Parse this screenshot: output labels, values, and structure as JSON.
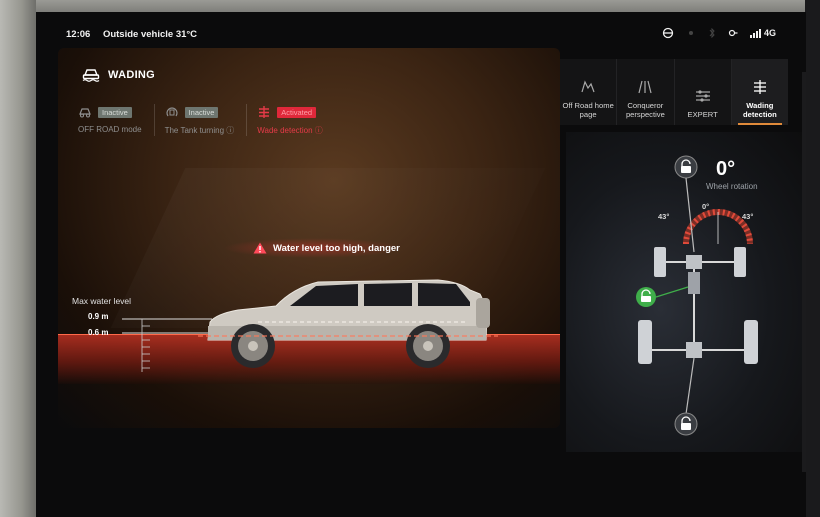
{
  "status": {
    "time": "12:06",
    "outside_temp": "Outside vehicle 31°C",
    "network": "4G"
  },
  "header": {
    "title": "WADING"
  },
  "modes": [
    {
      "badge": "Inactive",
      "label": "OFF ROAD mode"
    },
    {
      "badge": "Inactive",
      "label": "The Tank turning ⓘ"
    },
    {
      "badge": "Activated",
      "label": "Wade detection ⓘ"
    }
  ],
  "warning": {
    "text": "Water level too high, danger"
  },
  "water_scale": {
    "title": "Max water level",
    "max": "0.9 m",
    "current": "0.6 m"
  },
  "tabs": [
    {
      "label": "Off Road home page",
      "active": false
    },
    {
      "label": "Conqueror perspective",
      "active": false
    },
    {
      "label": "EXPERT",
      "active": false
    },
    {
      "label": "Wading detection",
      "active": true
    }
  ],
  "wheel": {
    "rotation": "0°",
    "rotation_label": "Wheel rotation",
    "left_angle": "43°",
    "center_angle": "0°",
    "right_angle": "43°"
  },
  "colors": {
    "accent_orange": "#e08a3a",
    "danger_red": "#e0283a",
    "lock_green": "#3fae4a"
  }
}
